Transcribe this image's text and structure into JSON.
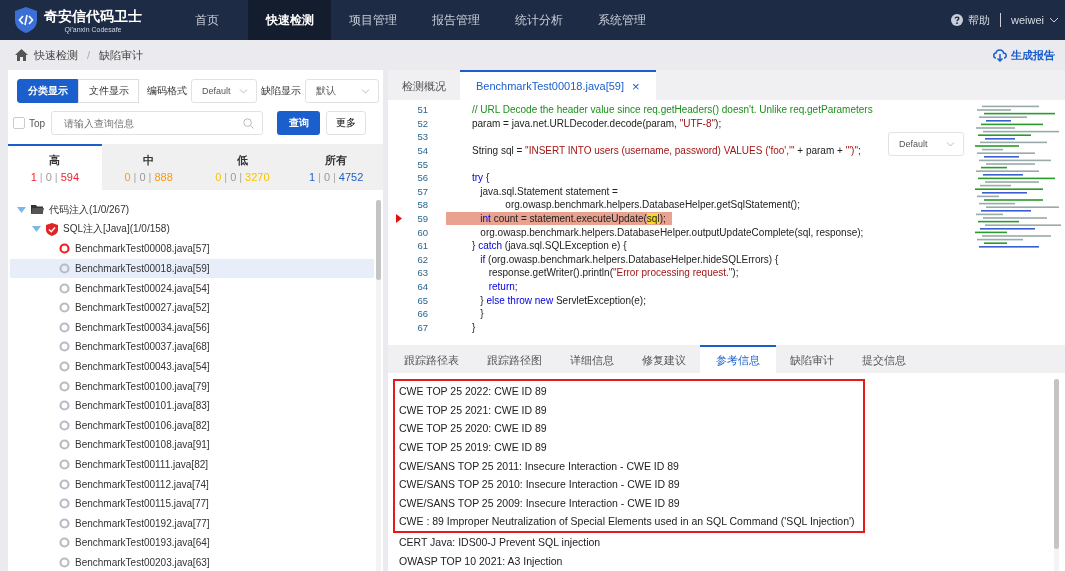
{
  "header": {
    "brand": "奇安信代码卫士",
    "brand_sub": "Qi'anxin Codesafe",
    "nav": [
      {
        "label": "首页",
        "selected": false
      },
      {
        "label": "快速检测",
        "selected": true
      },
      {
        "label": "项目管理",
        "selected": false
      },
      {
        "label": "报告管理",
        "selected": false
      },
      {
        "label": "统计分析",
        "selected": false
      },
      {
        "label": "系统管理",
        "selected": false
      }
    ],
    "help": "帮助",
    "user": "weiwei"
  },
  "breadcrumb": {
    "items": [
      "快速检测",
      "缺陷审计"
    ],
    "separator": "/",
    "action": "生成报告"
  },
  "left": {
    "view_toggle": [
      {
        "label": "分类显示",
        "selected": true
      },
      {
        "label": "文件显示",
        "selected": false
      }
    ],
    "encoding_label": "编码格式",
    "encoding_value": "Default",
    "defect_label": "缺陷显示",
    "defect_value": "默认",
    "count_separator": "|",
    "top": {
      "label": "Top",
      "checked": false
    },
    "search": {
      "placeholder": "请输入查询信息"
    },
    "query_button": "查询",
    "more_button": "更多",
    "severity_tabs": [
      {
        "label": "高",
        "selected": true,
        "color": "#f5222d",
        "counts": [
          "1",
          "0",
          "594"
        ]
      },
      {
        "label": "中",
        "selected": false,
        "color": "#fa9a16",
        "counts": [
          "0",
          "0",
          "888"
        ]
      },
      {
        "label": "低",
        "selected": false,
        "color": "#f5c400",
        "counts": [
          "0",
          "0",
          "3270"
        ]
      },
      {
        "label": "所有",
        "selected": false,
        "color": "#1f5fc7",
        "counts": [
          "1",
          "0",
          "4752"
        ]
      }
    ],
    "tree": [
      {
        "label": "代码注入(1/0/267)",
        "expanded": true,
        "children": [
          {
            "label": "SQL注入[Java](1/0/158)",
            "expanded": true,
            "children": [
              {
                "label": "BenchmarkTest00008.java[57]",
                "flagged": true,
                "selected": false
              },
              {
                "label": "BenchmarkTest00018.java[59]",
                "flagged": false,
                "selected": true
              },
              {
                "label": "BenchmarkTest00024.java[54]",
                "flagged": false,
                "selected": false
              },
              {
                "label": "BenchmarkTest00027.java[52]",
                "flagged": false,
                "selected": false
              },
              {
                "label": "BenchmarkTest00034.java[56]",
                "flagged": false,
                "selected": false
              },
              {
                "label": "BenchmarkTest00037.java[68]",
                "flagged": false,
                "selected": false
              },
              {
                "label": "BenchmarkTest00043.java[54]",
                "flagged": false,
                "selected": false
              },
              {
                "label": "BenchmarkTest00100.java[79]",
                "flagged": false,
                "selected": false
              },
              {
                "label": "BenchmarkTest00101.java[83]",
                "flagged": false,
                "selected": false
              },
              {
                "label": "BenchmarkTest00106.java[82]",
                "flagged": false,
                "selected": false
              },
              {
                "label": "BenchmarkTest00108.java[91]",
                "flagged": false,
                "selected": false
              },
              {
                "label": "BenchmarkTest00111.java[82]",
                "flagged": false,
                "selected": false
              },
              {
                "label": "BenchmarkTest00112.java[74]",
                "flagged": false,
                "selected": false
              },
              {
                "label": "BenchmarkTest00115.java[77]",
                "flagged": false,
                "selected": false
              },
              {
                "label": "BenchmarkTest00192.java[77]",
                "flagged": false,
                "selected": false
              },
              {
                "label": "BenchmarkTest00193.java[64]",
                "flagged": false,
                "selected": false
              },
              {
                "label": "BenchmarkTest00203.java[63]",
                "flagged": false,
                "selected": false
              }
            ]
          }
        ]
      }
    ]
  },
  "editor": {
    "tabs": [
      {
        "label": "检测概况",
        "selected": false,
        "closable": false
      },
      {
        "label": "BenchmarkTest00018.java[59]",
        "selected": true,
        "closable": true
      }
    ],
    "close_glyph": "×",
    "encoding_value": "Default",
    "lines": [
      {
        "number": "51",
        "highlighted": false,
        "tokens": [
          {
            "kind": "comment",
            "text": "// URL Decode the header value since req.getHeaders() doesn't. Unlike req.getParameters"
          }
        ]
      },
      {
        "number": "52",
        "highlighted": false,
        "tokens": [
          {
            "kind": "plain",
            "text": "param = java.net.URLDecoder.decode(param, "
          },
          {
            "kind": "string",
            "text": "\"UTF-8\""
          },
          {
            "kind": "plain",
            "text": ");"
          }
        ]
      },
      {
        "number": "53",
        "highlighted": false
      },
      {
        "number": "54",
        "highlighted": false,
        "tokens": [
          {
            "kind": "plain",
            "text": "String sql = "
          },
          {
            "kind": "string",
            "text": "\"INSERT INTO users (username, password) VALUES ('foo','\""
          },
          {
            "kind": "plain",
            "text": " + param + "
          },
          {
            "kind": "string",
            "text": "\"')\""
          },
          {
            "kind": "plain",
            "text": ";"
          }
        ]
      },
      {
        "number": "55",
        "highlighted": false
      },
      {
        "number": "56",
        "highlighted": false,
        "tokens": [
          {
            "kind": "keyword",
            "text": "try"
          },
          {
            "kind": "plain",
            "text": " {"
          }
        ]
      },
      {
        "number": "57",
        "highlighted": false,
        "tokens": [
          {
            "kind": "plain",
            "text": "   java.sql.Statement statement ="
          }
        ]
      },
      {
        "number": "58",
        "highlighted": false,
        "tokens": [
          {
            "kind": "plain",
            "text": "            org.owasp.benchmark.helpers.DatabaseHelper.getSqlStatement();"
          }
        ]
      },
      {
        "number": "59",
        "highlighted": true,
        "tokens": [
          {
            "kind": "keyword",
            "text": "   int"
          },
          {
            "kind": "plain",
            "text": " count = statement.executeUpdate("
          },
          {
            "kind": "match",
            "text": "sql"
          },
          {
            "kind": "plain",
            "text": ");"
          }
        ]
      },
      {
        "number": "60",
        "highlighted": false,
        "tokens": [
          {
            "kind": "plain",
            "text": "   org.owasp.benchmark.helpers.DatabaseHelper.outputUpdateComplete(sql, response);"
          }
        ]
      },
      {
        "number": "61",
        "highlighted": false,
        "tokens": [
          {
            "kind": "plain",
            "text": "} "
          },
          {
            "kind": "keyword",
            "text": "catch"
          },
          {
            "kind": "plain",
            "text": " (java.sql.SQLException e) {"
          }
        ]
      },
      {
        "number": "62",
        "highlighted": false,
        "tokens": [
          {
            "kind": "keyword",
            "text": "   if"
          },
          {
            "kind": "plain",
            "text": " (org.owasp.benchmark.helpers.DatabaseHelper.hideSQLErrors) {"
          }
        ]
      },
      {
        "number": "63",
        "highlighted": false,
        "tokens": [
          {
            "kind": "plain",
            "text": "      response.getWriter().println("
          },
          {
            "kind": "string",
            "text": "\"Error processing request.\""
          },
          {
            "kind": "plain",
            "text": ");"
          }
        ]
      },
      {
        "number": "64",
        "highlighted": false,
        "tokens": [
          {
            "kind": "keyword",
            "text": "      return"
          },
          {
            "kind": "plain",
            "text": ";"
          }
        ]
      },
      {
        "number": "65",
        "highlighted": false,
        "tokens": [
          {
            "kind": "plain",
            "text": "   } "
          },
          {
            "kind": "keyword",
            "text": "else throw new"
          },
          {
            "kind": "plain",
            "text": " ServletException(e);"
          }
        ]
      },
      {
        "number": "66",
        "highlighted": false,
        "tokens": [
          {
            "kind": "plain",
            "text": "   }"
          }
        ]
      },
      {
        "number": "67",
        "highlighted": false,
        "tokens": [
          {
            "kind": "plain",
            "text": "}"
          }
        ]
      }
    ]
  },
  "detail": {
    "tabs": [
      {
        "label": "跟踪路径表",
        "selected": false
      },
      {
        "label": "跟踪路径图",
        "selected": false
      },
      {
        "label": "详细信息",
        "selected": false
      },
      {
        "label": "修复建议",
        "selected": false
      },
      {
        "label": "参考信息",
        "selected": true
      },
      {
        "label": "缺陷审计",
        "selected": false
      },
      {
        "label": "提交信息",
        "selected": false
      }
    ],
    "boxed_references": [
      "CWE TOP 25 2022: CWE ID 89",
      "CWE TOP 25 2021: CWE ID 89",
      "CWE TOP 25 2020: CWE ID 89",
      "CWE TOP 25 2019: CWE ID 89",
      "CWE/SANS TOP 25 2011: Insecure Interaction - CWE ID 89",
      "CWE/SANS TOP 25 2010: Insecure Interaction - CWE ID 89",
      "CWE/SANS TOP 25 2009: Insecure Interaction - CWE ID 89",
      "CWE : 89 Improper Neutralization of Special Elements used in an SQL Command ('SQL Injection')"
    ],
    "other_references": [
      "CERT Java: IDS00-J Prevent SQL injection",
      "OWASP TOP 10 2021: A3 Injection"
    ]
  }
}
